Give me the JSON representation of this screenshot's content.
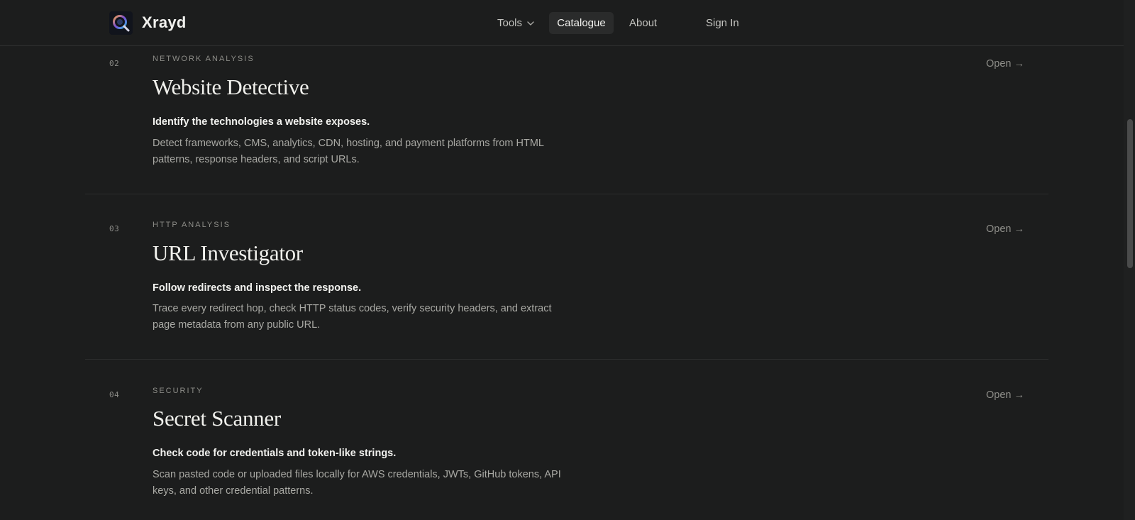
{
  "header": {
    "brand": "Xrayd",
    "nav": {
      "tools": "Tools",
      "catalogue": "Catalogue",
      "about": "About",
      "sign_in": "Sign In"
    },
    "active_item": "Catalogue",
    "icons": [
      "xrayd-logo-icon",
      "chevron-down-icon"
    ]
  },
  "tools": [
    {
      "number": "02",
      "category": "NETWORK ANALYSIS",
      "title": "Website Detective",
      "tagline": "Identify the technologies a website exposes.",
      "description": "Detect frameworks, CMS, analytics, CDN, hosting, and payment platforms from HTML patterns, response headers, and script URLs.",
      "open_label": "Open →"
    },
    {
      "number": "03",
      "category": "HTTP ANALYSIS",
      "title": "URL Investigator",
      "tagline": "Follow redirects and inspect the response.",
      "description": "Trace every redirect hop, check HTTP status codes, verify security headers, and extract page metadata from any public URL.",
      "open_label": "Open →"
    },
    {
      "number": "04",
      "category": "SECURITY",
      "title": "Secret Scanner",
      "tagline": "Check code for credentials and token-like strings.",
      "description": "Scan pasted code or uploaded files locally for AWS credentials, JWTs, GitHub tokens, API keys, and other credential patterns.",
      "open_label": "Open →"
    }
  ],
  "colors": {
    "background": "#1c1d1d",
    "text_primary": "#f0f0ec",
    "text_muted": "#a9a9a4",
    "nav_active_bg": "#2a2b2b"
  }
}
